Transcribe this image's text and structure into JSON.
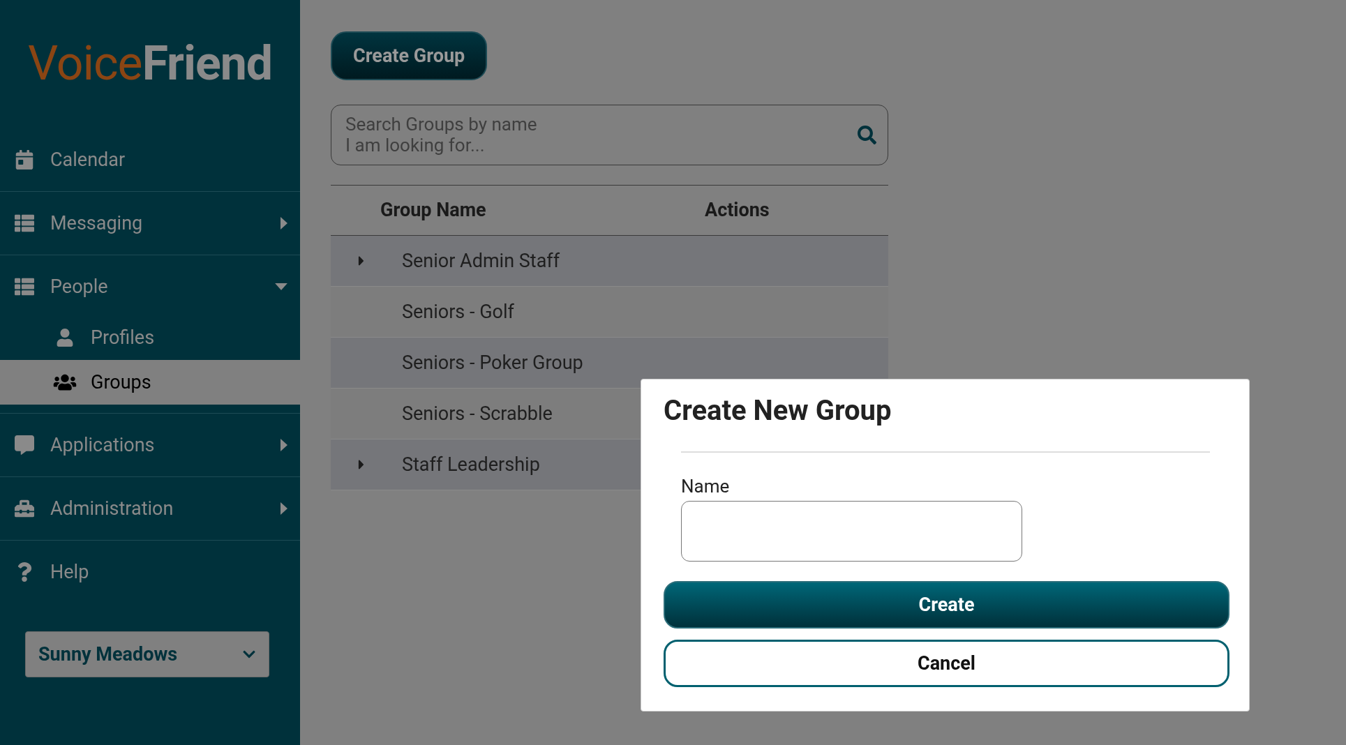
{
  "logo": {
    "first": "Voice",
    "second": "Friend"
  },
  "sidebar": {
    "items": [
      {
        "label": "Calendar",
        "kind": "link",
        "selected": false
      },
      {
        "label": "Messaging",
        "kind": "menu",
        "expanded": false,
        "selected": false
      },
      {
        "label": "People",
        "kind": "menu",
        "expanded": true,
        "selected": false,
        "children": [
          {
            "label": "Profiles",
            "selected": false
          },
          {
            "label": "Groups",
            "selected": true
          }
        ]
      },
      {
        "label": "Applications",
        "kind": "menu",
        "expanded": false,
        "selected": false
      },
      {
        "label": "Administration",
        "kind": "menu",
        "expanded": false,
        "selected": false
      },
      {
        "label": "Help",
        "kind": "link",
        "selected": false
      }
    ],
    "site_select": {
      "value": "Sunny Meadows"
    }
  },
  "toolbar": {
    "create_button": "Create Group"
  },
  "search": {
    "placeholder": "Search Groups by name\nI am looking for..."
  },
  "table": {
    "columns": [
      "Group Name",
      "Actions"
    ],
    "rows": [
      {
        "name": "Senior Admin Staff",
        "kind": "parent"
      },
      {
        "name": "Seniors - Golf",
        "kind": "leaf"
      },
      {
        "name": "Seniors - Poker Group",
        "kind": "leaf"
      },
      {
        "name": "Seniors - Scrabble",
        "kind": "leaf"
      },
      {
        "name": "Staff Leadership",
        "kind": "parent"
      }
    ]
  },
  "dialog": {
    "title": "Create New Group",
    "field_label": "Name",
    "buttons": [
      {
        "label": "Create",
        "kind": "primary"
      },
      {
        "label": "Cancel",
        "kind": "secondary"
      }
    ]
  }
}
